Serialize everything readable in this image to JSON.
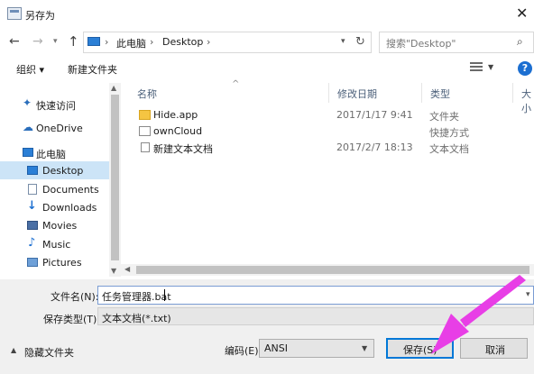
{
  "window": {
    "title": "另存为"
  },
  "address": {
    "segments": [
      "此电脑",
      "Desktop"
    ],
    "search_placeholder": "搜索\"Desktop\""
  },
  "toolbar": {
    "organize": "组织 ▾",
    "new_folder": "新建文件夹"
  },
  "nav": {
    "items": [
      {
        "label": "快速访问",
        "icon": "pin-icon"
      },
      {
        "label": "OneDrive",
        "icon": "cloud-icon"
      },
      {
        "label": "此电脑",
        "icon": "pc-icon"
      },
      {
        "label": "Desktop",
        "icon": "desktop-icon",
        "selected": true
      },
      {
        "label": "Documents",
        "icon": "documents-icon"
      },
      {
        "label": "Downloads",
        "icon": "download-icon"
      },
      {
        "label": "Movies",
        "icon": "movies-icon"
      },
      {
        "label": "Music",
        "icon": "music-icon"
      },
      {
        "label": "Pictures",
        "icon": "pictures-icon"
      }
    ]
  },
  "columns": {
    "name": "名称",
    "date": "修改日期",
    "type": "类型",
    "size": "大小"
  },
  "files": [
    {
      "name": "Hide.app",
      "date": "2017/1/17 9:41",
      "type": "文件夹",
      "icon": "folder-icon"
    },
    {
      "name": "ownCloud",
      "date": "",
      "type": "快捷方式",
      "icon": "shortcut-icon"
    },
    {
      "name": "新建文本文档",
      "date": "2017/2/7 18:13",
      "type": "文本文档",
      "icon": "text-doc-icon"
    }
  ],
  "form": {
    "filename_label": "文件名(N):",
    "filename_value": "任务管理器.bat",
    "savetype_label": "保存类型(T):",
    "savetype_value": "文本文档(*.txt)",
    "encoding_label": "编码(E):",
    "encoding_value": "ANSI",
    "hide_folders": "隐藏文件夹",
    "save": "保存(S)",
    "cancel": "取消"
  },
  "colors": {
    "accent": "#0078d7",
    "selection": "#cce4f7",
    "annotation_arrow": "#e83ee6"
  }
}
